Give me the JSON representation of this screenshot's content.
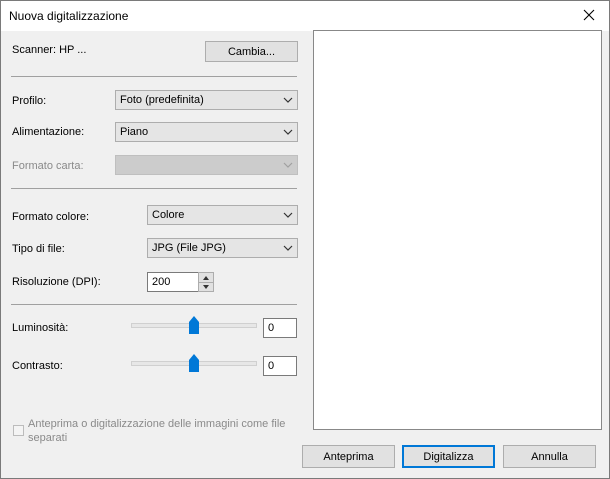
{
  "window": {
    "title": "Nuova digitalizzazione"
  },
  "scanner": {
    "label": "Scanner: HP ...",
    "change_button": "Cambia..."
  },
  "fields": {
    "profile": {
      "label": "Profilo:",
      "value": "Foto (predefinita)"
    },
    "source": {
      "label": "Alimentazione:",
      "value": "Piano"
    },
    "paper_size": {
      "label": "Formato carta:",
      "value": ""
    },
    "color_format": {
      "label": "Formato colore:",
      "value": "Colore"
    },
    "file_type": {
      "label": "Tipo di file:",
      "value": "JPG (File JPG)"
    },
    "resolution": {
      "label": "Risoluzione (DPI):",
      "value": "200"
    }
  },
  "sliders": {
    "brightness": {
      "label": "Luminosità:",
      "value": "0",
      "level": 0.5
    },
    "contrast": {
      "label": "Contrasto:",
      "value": "0",
      "level": 0.5
    }
  },
  "options": {
    "separate_files_label": "Anteprima o digitalizzazione delle immagini come file separati",
    "separate_files_checked": false
  },
  "buttons": {
    "preview": "Anteprima",
    "scan": "Digitalizza",
    "cancel": "Annulla"
  },
  "colors": {
    "accent": "#0078d7"
  },
  "icons": {
    "close": "close-icon",
    "dropdown": "chevron-down-icon"
  }
}
